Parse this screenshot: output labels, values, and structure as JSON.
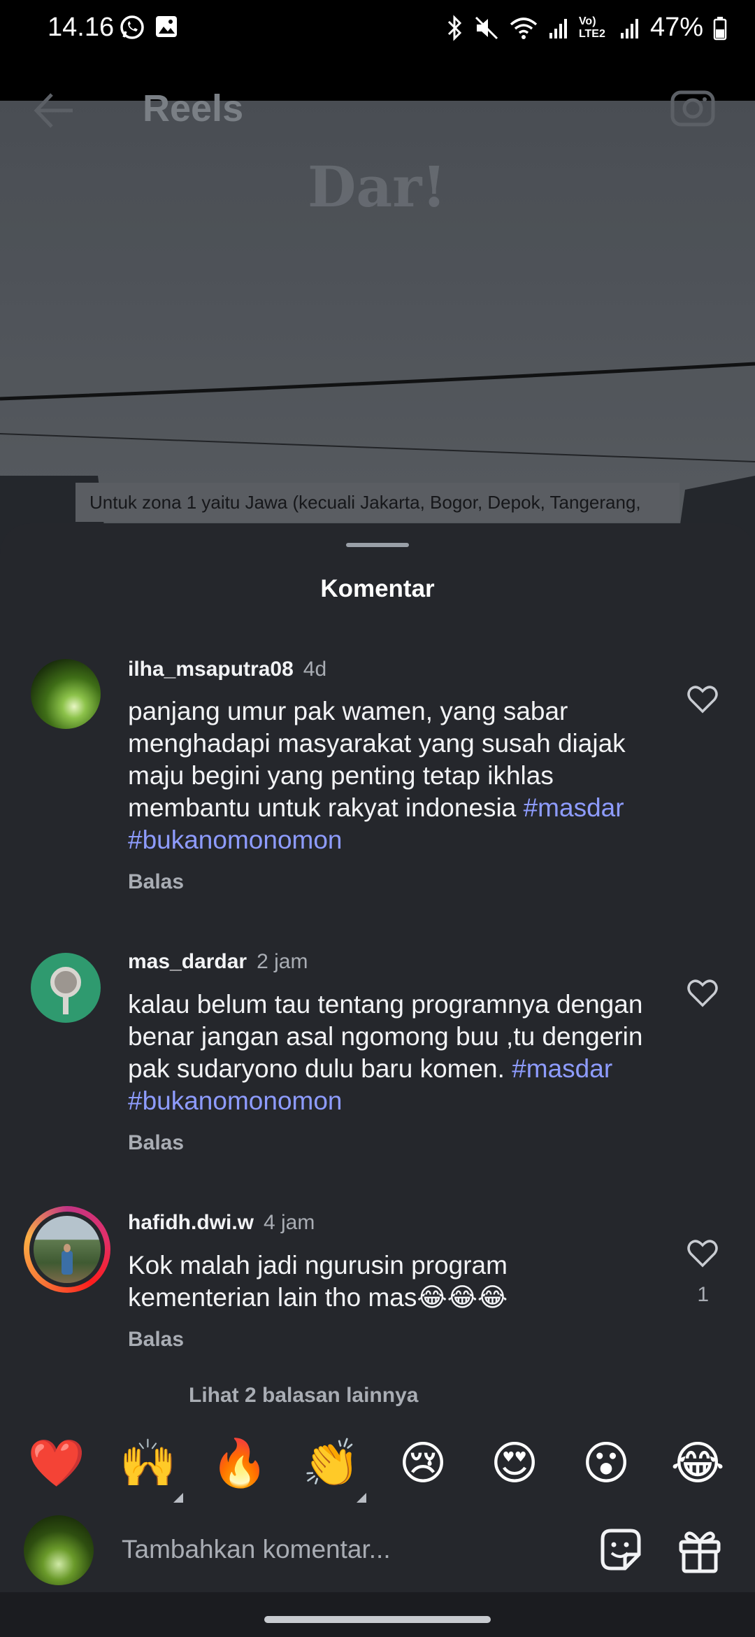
{
  "status_bar": {
    "time": "14.16",
    "battery": "47%",
    "network": "Vo) LTE2"
  },
  "video": {
    "title": "Reels",
    "watermark": "Dar!",
    "caption": "Untuk zona 1 yaitu Jawa (kecuali Jakarta, Bogor, Depok, Tangerang,"
  },
  "sheet": {
    "title": "Komentar"
  },
  "comments": [
    {
      "username": "ilha_msaputra08",
      "time": "4d",
      "text_plain": "panjang umur pak wamen, yang sabar menghadapi masyarakat yang susah diajak maju begini yang penting tetap ikhlas membantu untuk rakyat indonesia",
      "hashtags": "#masdar #bukanomonomon",
      "reply_label": "Balas",
      "likes": ""
    },
    {
      "username": "mas_dardar",
      "time": "2 jam",
      "text_plain": "kalau belum tau tentang programnya dengan benar jangan asal ngomong buu ,tu dengerin pak sudaryono dulu baru komen.",
      "hashtags": "#masdar #bukanomonomon",
      "reply_label": "Balas",
      "likes": ""
    },
    {
      "username": "hafidh.dwi.w",
      "time": "4 jam",
      "text_plain": "Kok malah jadi ngurusin program kementerian lain tho mas😂😂😂",
      "hashtags": "",
      "reply_label": "Balas",
      "likes": "1"
    }
  ],
  "more_replies": "Lihat 2 balasan lainnya",
  "quick_emojis": [
    "❤️",
    "🙌",
    "🔥",
    "👏",
    "😢",
    "😍",
    "😮",
    "😂"
  ],
  "input": {
    "placeholder": "Tambahkan komentar..."
  },
  "colors": {
    "sheet_bg": "#25272c",
    "hashtag": "#8e9cff",
    "muted": "#a9adb4"
  }
}
